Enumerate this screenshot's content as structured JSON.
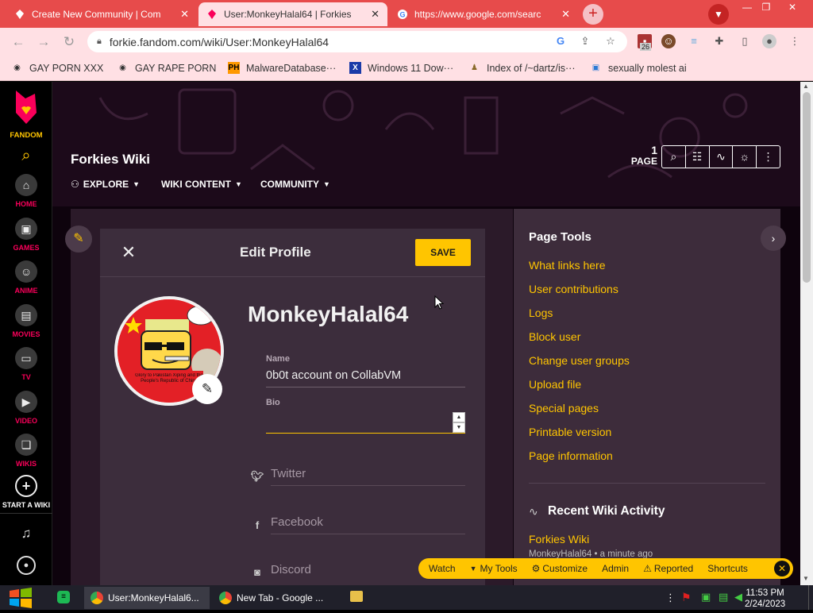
{
  "tabs": [
    {
      "title": "Create New Community | Com",
      "active": false
    },
    {
      "title": "User:MonkeyHalal64 | Forkies",
      "active": true
    },
    {
      "title": "https://www.google.com/searc",
      "active": false
    }
  ],
  "window_controls": {
    "minimize": "—",
    "restore": "❐",
    "close": "✕"
  },
  "address_bar": {
    "url": "forkie.fandom.com/wiki/User:MonkeyHalal64"
  },
  "extension_badge": "26",
  "bookmarks": [
    {
      "label": "GAY PORN XXX"
    },
    {
      "label": "GAY RAPE PORN"
    },
    {
      "label": "MalwareDatabase···",
      "icon_text": "PH"
    },
    {
      "label": "Windows 11 Dow···",
      "icon_text": "X"
    },
    {
      "label": "Index of /~dartz/is···"
    },
    {
      "label": "sexually molest ai"
    }
  ],
  "fandom_sidebar": {
    "brand": "FANDOM",
    "items": [
      {
        "label": "HOME"
      },
      {
        "label": "GAMES"
      },
      {
        "label": "ANIME"
      },
      {
        "label": "MOVIES"
      },
      {
        "label": "TV"
      },
      {
        "label": "VIDEO"
      },
      {
        "label": "WIKIS"
      },
      {
        "label": "START A WIKI"
      }
    ]
  },
  "wiki": {
    "title": "Forkies Wiki",
    "nav": [
      {
        "label": "EXPLORE"
      },
      {
        "label": "WIKI CONTENT"
      },
      {
        "label": "COMMUNITY"
      }
    ],
    "page_count": "1",
    "page_label": "PAGE"
  },
  "edit_profile": {
    "title": "Edit Profile",
    "save_label": "SAVE",
    "username": "MonkeyHalal64",
    "avatar_caption": "Glory to Pakistan Xiping and the People's Republic of China",
    "name_label": "Name",
    "name_value": "0b0t account on CollabVM",
    "bio_label": "Bio",
    "bio_value": "",
    "social": [
      {
        "label": "Twitter"
      },
      {
        "label": "Facebook"
      },
      {
        "label": "Discord"
      }
    ]
  },
  "page_tools": {
    "title": "Page Tools",
    "links": [
      "What links here",
      "User contributions",
      "Logs",
      "Block user",
      "Change user groups",
      "Upload file",
      "Special pages",
      "Printable version",
      "Page information"
    ]
  },
  "recent_activity": {
    "title": "Recent Wiki Activity",
    "item_link": "Forkies Wiki",
    "item_meta": "MonkeyHalal64 • a minute ago"
  },
  "bottom_toolbar": {
    "items": [
      "Watch",
      "My Tools",
      "Customize",
      "Admin",
      "Reported",
      "Shortcuts"
    ]
  },
  "taskbar": {
    "apps": [
      {
        "label": "User:MonkeyHalal6..."
      },
      {
        "label": "New Tab - Google ..."
      }
    ],
    "time": "11:53 PM",
    "date": "2/24/2023"
  },
  "colors": {
    "chrome_accent": "#e74b4b",
    "fandom_pink": "#fa005a",
    "accent_yellow": "#ffc500"
  }
}
